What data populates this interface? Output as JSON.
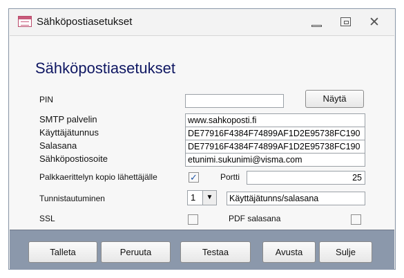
{
  "window": {
    "title": "Sähköpostiasetukset",
    "icon": "form-icon",
    "controls": {
      "minimize": "minimize-icon",
      "maximize": "maximize-icon",
      "close": "close-icon"
    }
  },
  "form": {
    "heading": "Sähköpostiasetukset",
    "pin": {
      "label": "PIN",
      "value": ""
    },
    "show_button": "Näytä",
    "smtp": {
      "label": "SMTP palvelin",
      "value": "www.sahkoposti.fi"
    },
    "username": {
      "label": "Käyttäjätunnus",
      "value": "DE77916F4384F74899AF1D2E95738FC190"
    },
    "password": {
      "label": "Salasana",
      "value": "DE77916F4384F74899AF1D2E95738FC190"
    },
    "email": {
      "label": "Sähköpostiosoite",
      "value": "etunimi.sukunimi@visma.com"
    },
    "copy": {
      "label": "Palkkaerittelyn  kopio lähettäjälle",
      "checked": true,
      "checkmark": "✓"
    },
    "port": {
      "label": "Portti",
      "value": "25"
    },
    "auth": {
      "label": "Tunnistautuminen",
      "number": "1",
      "dropdown_icon": "▼",
      "value": "Käyttäjätunns/salasana"
    },
    "ssl": {
      "label": "SSL",
      "checked": false
    },
    "pdf_password": {
      "label": "PDF salasana",
      "checked": false
    }
  },
  "buttons": {
    "save": "Talleta",
    "cancel": "Peruuta",
    "test": "Testaa",
    "help": "Avusta",
    "close": "Sulje"
  },
  "colors": {
    "heading": "#0f1762",
    "bottom_bar": "#8b98ab",
    "checkmark": "#2256a5"
  }
}
